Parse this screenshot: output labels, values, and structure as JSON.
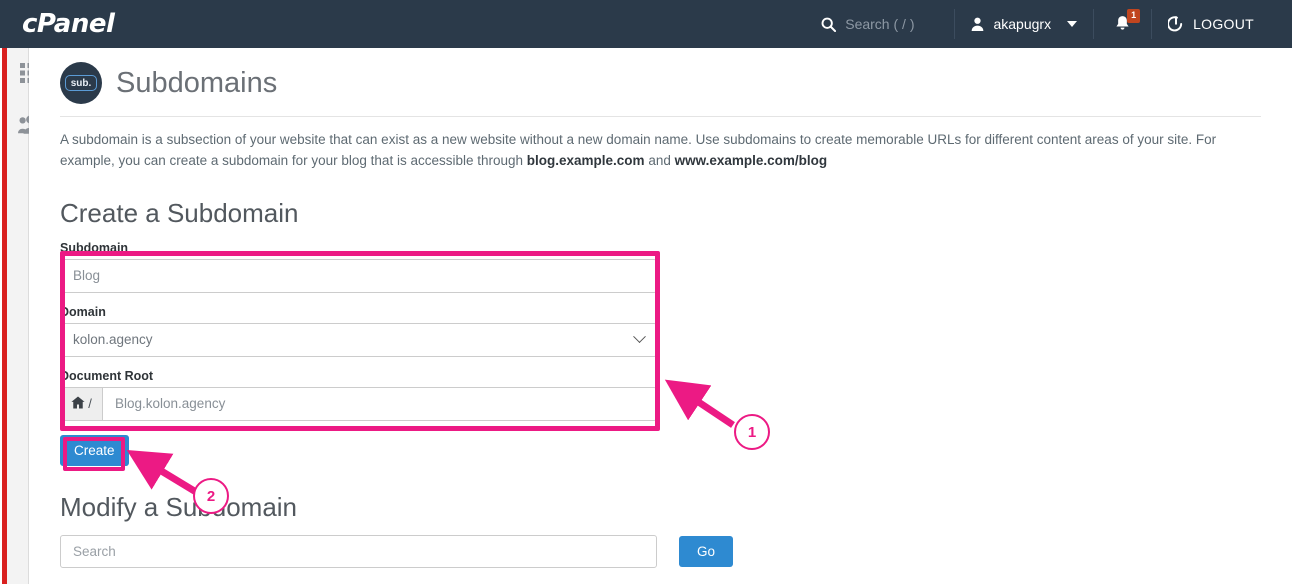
{
  "header": {
    "logo": "cPanel",
    "search_placeholder": "Search ( / )",
    "search_icon": "search-icon",
    "user": "akapugrx",
    "user_icon": "user-icon",
    "caret_icon": "chevron-down-icon",
    "bell_icon": "bell-icon",
    "notification_count": "1",
    "logout_label": "LOGOUT",
    "logout_icon": "logout-icon",
    "bg_color": "#2b3a4a"
  },
  "sidebar": {
    "accent_color": "#d9201f",
    "items": [
      {
        "name": "apps-grid-icon",
        "label": "Apps"
      },
      {
        "name": "users-icon",
        "label": "User Manager"
      }
    ]
  },
  "page": {
    "icon_label": "sub.",
    "title": "Subdomains",
    "description_part1": "A subdomain is a subsection of your website that can exist as a new website without a new domain name. Use subdomains to create memorable URLs for different content areas of your site. For example, you can create a subdomain for your blog that is accessible through ",
    "description_bold1": "blog.example.com",
    "description_mid": " and ",
    "description_bold2": "www.example.com/blog"
  },
  "create_section": {
    "heading": "Create a Subdomain",
    "subdomain_label": "Subdomain",
    "subdomain_value": "Blog",
    "domain_label": "Domain",
    "domain_value": "kolon.agency",
    "domain_chevron": "chevron-down-icon",
    "docroot_label": "Document Root",
    "docroot_prefix_icon": "home-icon",
    "docroot_prefix_slash": "/",
    "docroot_value": "Blog.kolon.agency",
    "create_button": "Create",
    "button_color": "#2e8ad1"
  },
  "modify_section": {
    "heading": "Modify a Subdomain",
    "search_placeholder": "Search",
    "go_button": "Go"
  },
  "annotations": {
    "highlight_color": "#ec1a84",
    "markers": [
      {
        "id": "1",
        "target": "create-subdomain-form"
      },
      {
        "id": "2",
        "target": "create-button"
      }
    ]
  }
}
